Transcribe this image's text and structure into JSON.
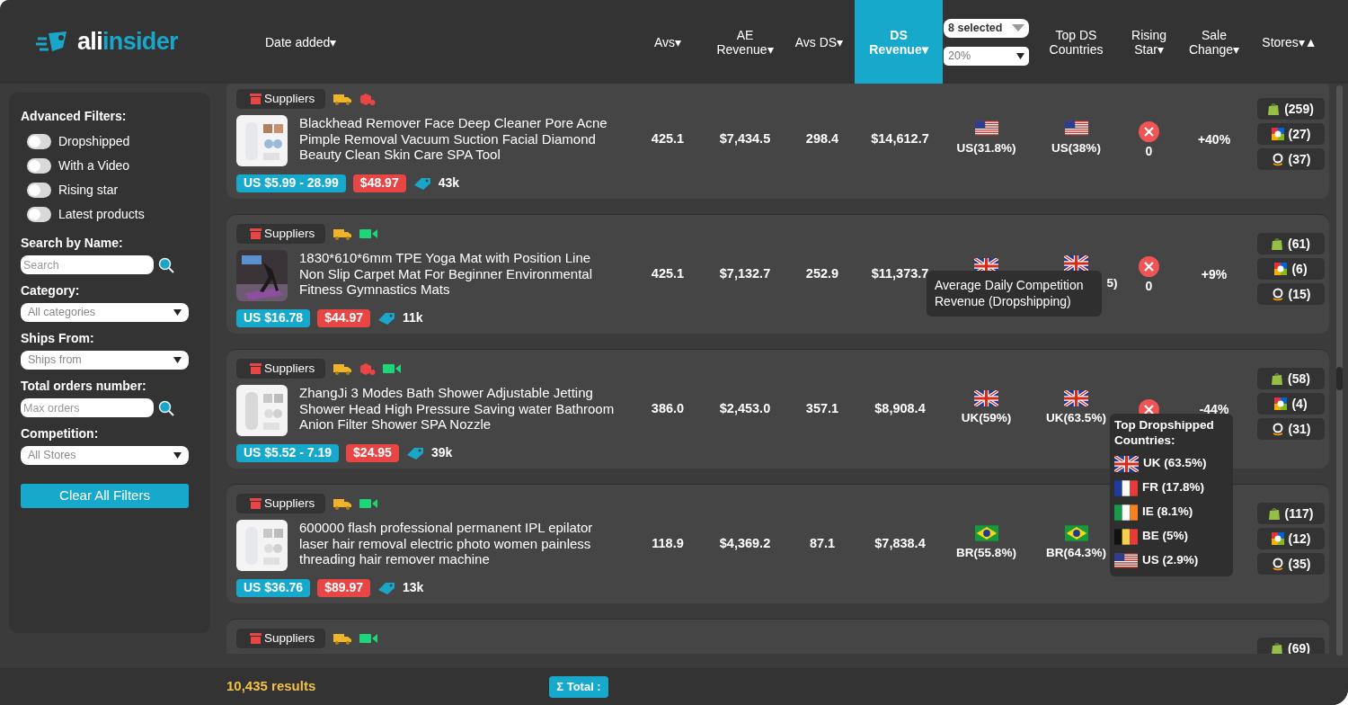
{
  "logo": {
    "part_1": "ali",
    "part_2": "insider"
  },
  "columns": [
    {
      "kind": "sort",
      "label": "Date added▾",
      "selected": false
    },
    {
      "kind": "sort",
      "label": "Avs▾",
      "selected": false
    },
    {
      "kind": "sort",
      "label": "AE Revenue▾",
      "selected": false
    },
    {
      "kind": "sort",
      "label": "Avs DS▾",
      "selected": false
    },
    {
      "kind": "sort",
      "label": "DS Revenue▾",
      "selected": true
    },
    {
      "kind": "controls",
      "multi_select": "8 selected",
      "percent_select": "20%"
    },
    {
      "kind": "sort",
      "label": "Top DS Countries",
      "selected": false
    },
    {
      "kind": "sort",
      "label": "Rising Star▾",
      "selected": false
    },
    {
      "kind": "sort",
      "label": "Sale Change▾",
      "selected": false
    },
    {
      "kind": "sort",
      "label": "Stores▾▲",
      "selected": false
    }
  ],
  "sidebar": {
    "title": "Advanced Filters:",
    "toggles": [
      {
        "label": "Dropshipped",
        "on": false
      },
      {
        "label": "With a Video",
        "on": false
      },
      {
        "label": "Rising star",
        "on": false
      },
      {
        "label": "Latest products",
        "on": false
      }
    ],
    "sections": [
      {
        "kind": "search",
        "label": "Search by Name:",
        "placeholder": "Search"
      },
      {
        "kind": "select",
        "label": "Category:",
        "value": "All categories"
      },
      {
        "kind": "select",
        "label": "Ships From:",
        "value": "Ships from"
      },
      {
        "kind": "search",
        "label": "Total orders number:",
        "placeholder": "Max orders"
      },
      {
        "kind": "select",
        "label": "Competition:",
        "value": "All Stores"
      }
    ],
    "button": "Clear All Filters"
  },
  "products": [
    {
      "supplier_label": "Suppliers",
      "badges": [
        {
          "kind": "shipping"
        },
        {
          "kind": "warehouse"
        }
      ],
      "title": "Blackhead Remover Face Deep Cleaner Pore Acne Pimple Removal Vacuum Suction Facial Diamond Beauty Clean Skin Care SPA Tool",
      "price_range": "US $5.99 - 28.99",
      "sale_price": "$48.97",
      "orders": "43k",
      "avs": "425.1",
      "ae_revenue": "$7,434.5",
      "avs_ds": "298.4",
      "ds_revenue": "$14,612.7",
      "countries": [
        {
          "kind": "us",
          "label": "US(31.8%)"
        },
        {
          "kind": "us",
          "label": "US(38%)"
        }
      ],
      "rising_star": {
        "rising": false,
        "count": "0"
      },
      "sale_change": "+40%",
      "stores": [
        {
          "kind": "shopify",
          "count": "(259)"
        },
        {
          "kind": "ebay",
          "count": "(27)"
        },
        {
          "kind": "amazon",
          "count": "(37)"
        }
      ]
    },
    {
      "supplier_label": "Suppliers",
      "badges": [
        {
          "kind": "shipping"
        },
        {
          "kind": "video"
        }
      ],
      "title": "1830*610*6mm TPE Yoga Mat with Position Line Non Slip Carpet Mat For Beginner Environmental Fitness Gymnastics Mats",
      "price_range": "US $16.78",
      "sale_price": "$44.97",
      "orders": "11k",
      "avs": "425.1",
      "ae_revenue": "$7,132.7",
      "avs_ds": "252.9",
      "ds_revenue": "$11,373.7",
      "countries": [
        {
          "kind": "uk"
        },
        {
          "kind": "uk",
          "label": "5)",
          "cut": true
        }
      ],
      "rising_star": {
        "rising": false,
        "count": "0"
      },
      "sale_change": "+9%",
      "stores": [
        {
          "kind": "shopify",
          "count": "(61)"
        },
        {
          "kind": "ebay",
          "count": "(6)"
        },
        {
          "kind": "amazon",
          "count": "(15)"
        }
      ]
    },
    {
      "supplier_label": "Suppliers",
      "badges": [
        {
          "kind": "shipping"
        },
        {
          "kind": "warehouse"
        },
        {
          "kind": "video"
        }
      ],
      "title": "ZhangJi 3 Modes Bath Shower Adjustable Jetting Shower Head High Pressure Saving water Bathroom Anion Filter Shower SPA Nozzle",
      "price_range": "US $5.52 - 7.19",
      "sale_price": "$24.95",
      "orders": "39k",
      "avs": "386.0",
      "ae_revenue": "$2,453.0",
      "avs_ds": "357.1",
      "ds_revenue": "$8,908.4",
      "countries": [
        {
          "kind": "uk",
          "label": "UK(59%)"
        },
        {
          "kind": "uk",
          "label": "UK(63.5%)"
        }
      ],
      "rising_star": {
        "rising": false
      },
      "sale_change": "-44%",
      "stores": [
        {
          "kind": "shopify",
          "count": "(58)"
        },
        {
          "kind": "ebay",
          "count": "(4)"
        },
        {
          "kind": "amazon",
          "count": "(31)"
        }
      ]
    },
    {
      "supplier_label": "Suppliers",
      "badges": [
        {
          "kind": "shipping"
        },
        {
          "kind": "video"
        }
      ],
      "title": "600000 flash professional permanent IPL epilator laser hair removal electric photo women painless threading hair remover machine",
      "price_range": "US $36.76",
      "sale_price": "$89.97",
      "orders": "13k",
      "avs": "118.9",
      "ae_revenue": "$4,369.2",
      "avs_ds": "87.1",
      "ds_revenue": "$7,838.4",
      "countries": [
        {
          "kind": "br",
          "label": "BR(55.8%)"
        },
        {
          "kind": "br",
          "label": "BR(64.3%)"
        }
      ],
      "stores": [
        {
          "kind": "shopify",
          "count": "(117)"
        },
        {
          "kind": "ebay",
          "count": "(12)"
        },
        {
          "kind": "amazon",
          "count": "(35)"
        }
      ]
    },
    {
      "supplier_label": "Suppliers",
      "badges": [
        {
          "kind": "shipping"
        },
        {
          "kind": "video"
        }
      ],
      "stores": [
        {
          "kind": "shopify",
          "count": "(69)"
        }
      ]
    }
  ],
  "tooltips": [
    {
      "kind": "text",
      "text": "Average Daily Competition Revenue (Dropshipping)"
    },
    {
      "kind": "countries",
      "title": "Top Dropshipped Countries:",
      "items": [
        {
          "kind": "uk",
          "label": "UK (63.5%)"
        },
        {
          "kind": "fr",
          "label": "FR (17.8%)"
        },
        {
          "kind": "ie",
          "label": "IE (8.1%)"
        },
        {
          "kind": "be",
          "label": "BE (5%)"
        },
        {
          "kind": "us",
          "label": "US (2.9%)"
        }
      ]
    }
  ],
  "footer": {
    "results": "10,435 results",
    "total_button": "Σ Total :"
  }
}
